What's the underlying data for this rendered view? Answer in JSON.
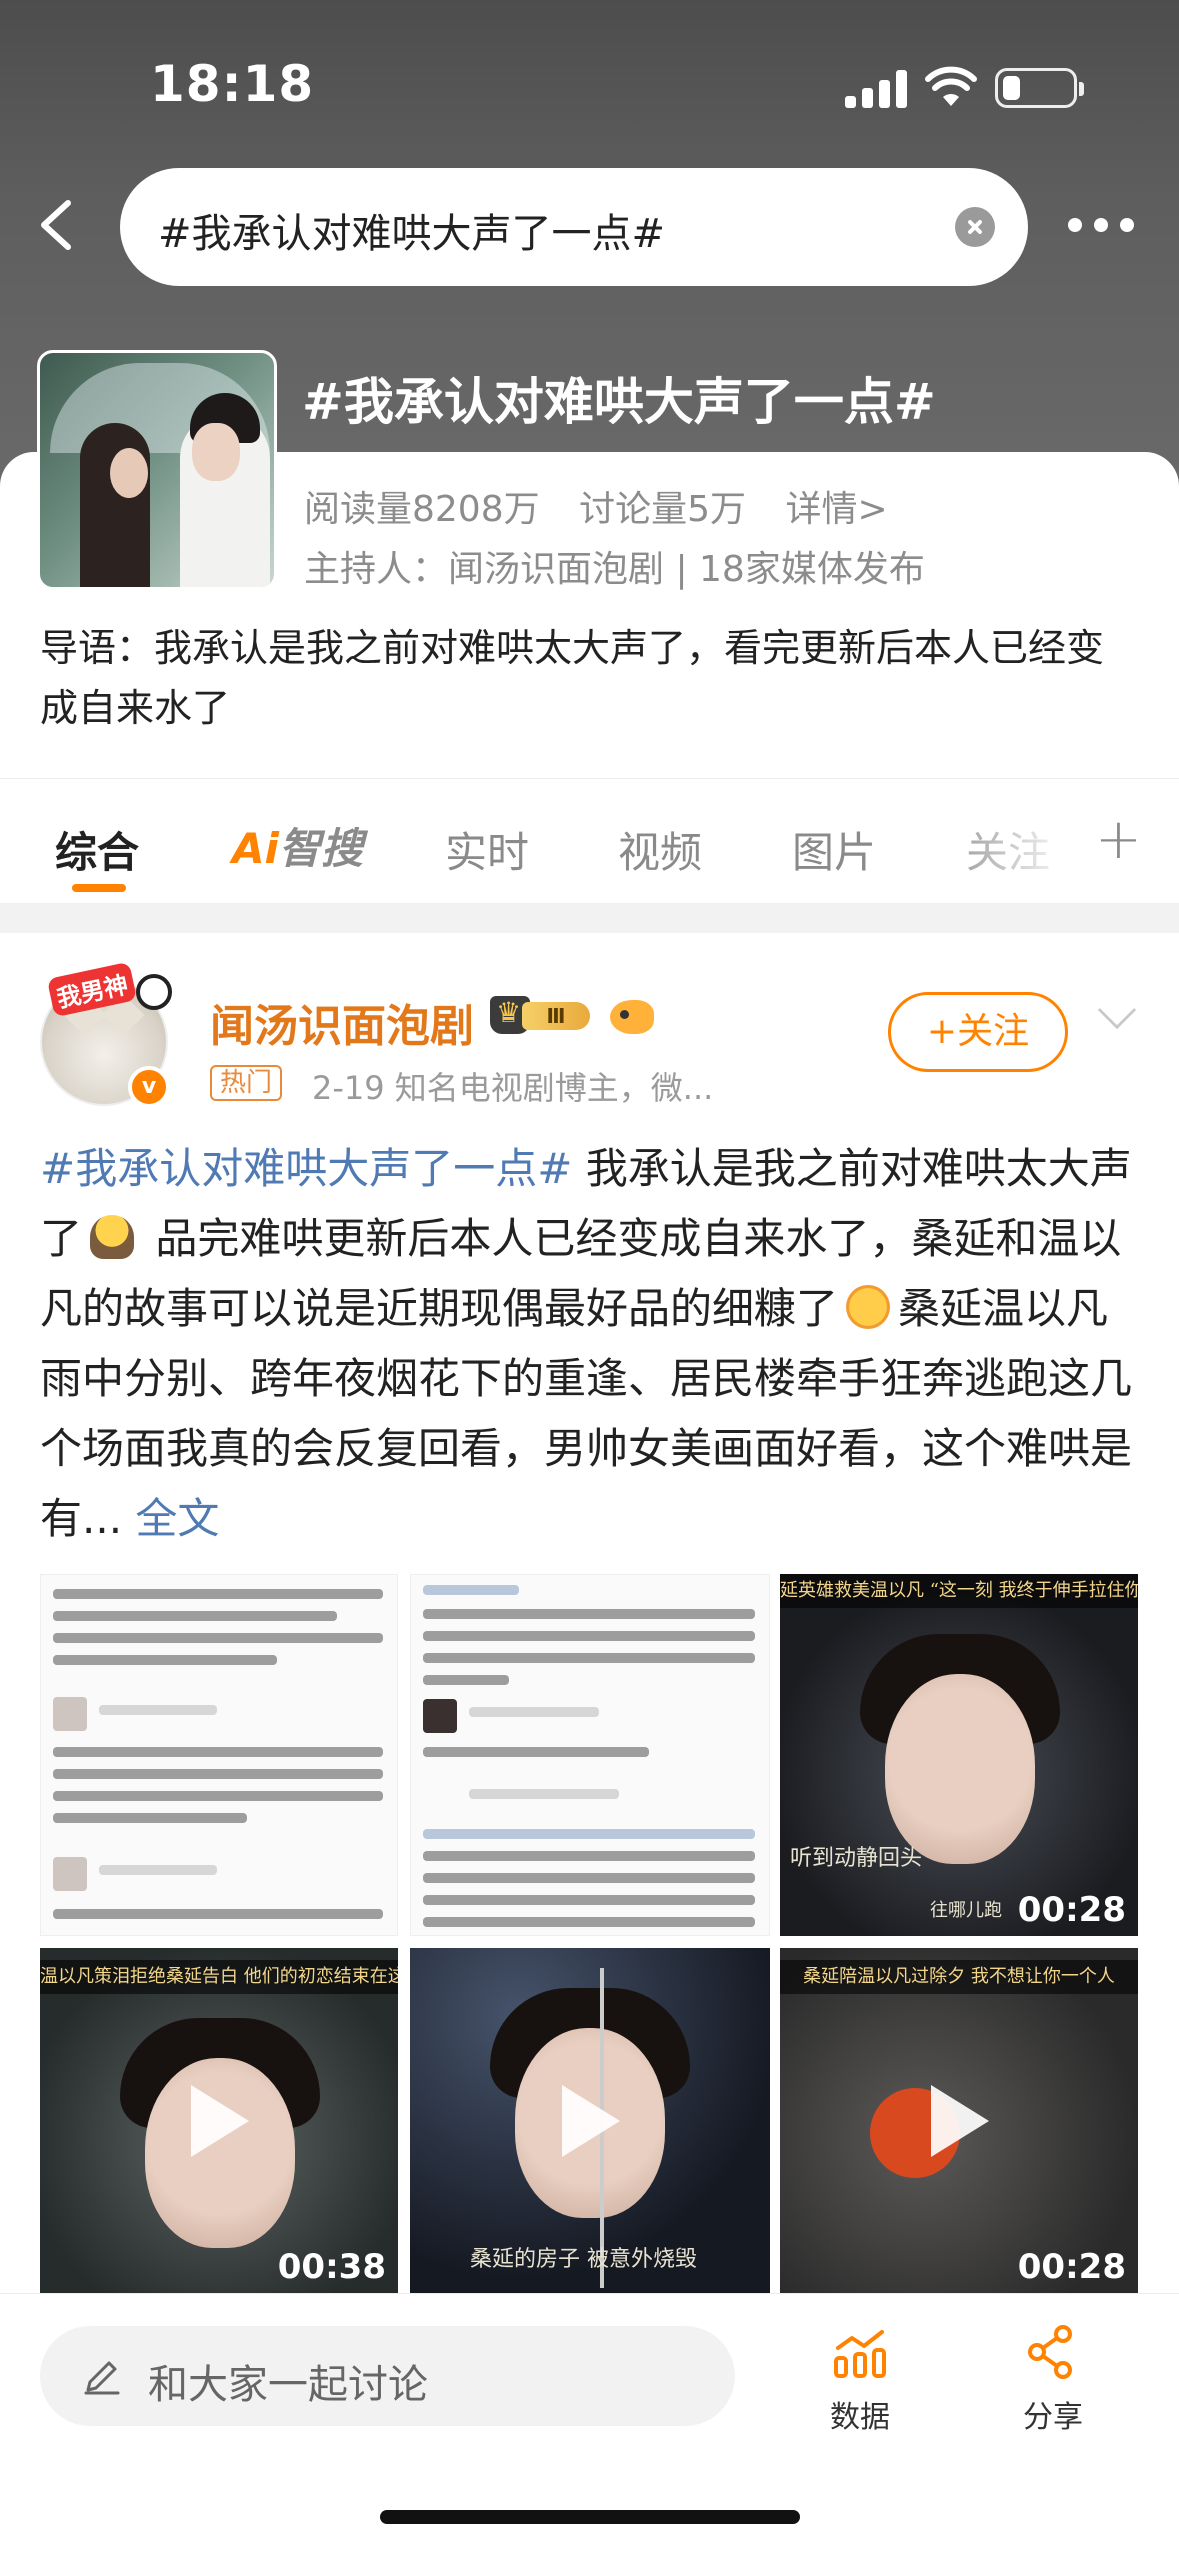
{
  "status_bar": {
    "time": "18:18"
  },
  "search": {
    "query": "#我承认对难哄大声了一点#"
  },
  "topic": {
    "title": "#我承认对难哄大声了一点#",
    "reads": "阅读量8208万",
    "discussions": "讨论量5万",
    "details_link": "详情>",
    "host_line": "主持人：闻汤识面泡剧 | 18家媒体发布",
    "intro": "导语：我承认是我之前对难哄太大声了，看完更新后本人已经变成自来水了"
  },
  "tabs": [
    {
      "label": "综合"
    },
    {
      "label": "智搜",
      "prefix": "Ai"
    },
    {
      "label": "实时"
    },
    {
      "label": "视频"
    },
    {
      "label": "图片"
    },
    {
      "label": "关注"
    }
  ],
  "post": {
    "author": "闻汤识面泡剧",
    "avatar_tag": "我男神",
    "level_badge": "Ⅲ",
    "hot_badge": "热门",
    "date_line": "2-19  知名电视剧博主，微...",
    "follow_label": "+关注",
    "topic_tag": "#我承认对难哄大声了一点#",
    "text_1": "  我承认是我之前对难哄太大声了",
    "text_2": "  品完难哄更新后本人已经变成自来水了，桑延和温以凡的故事可以说是近期现偶最好品的细糠了",
    "text_3": "桑延温以凡雨中分别、跨年夜烟花下的重逢、居民楼牵手狂奔逃跑这几个场面我真的会反复回看，男帅女美画面好看，这个难哄是有...",
    "more_link": " 全文",
    "media": [
      {
        "kind": "screenshot"
      },
      {
        "kind": "screenshot"
      },
      {
        "kind": "video",
        "caption": "延英雄救美温以凡 “这一刻 我终于伸手拉住你",
        "subtitle": "听到动静回头",
        "subtitle_right": "往哪儿跑",
        "duration": "00:28"
      },
      {
        "kind": "video",
        "caption": "温以凡策泪拒绝桑延告白 他们的初恋结束在这场大雨",
        "duration": "00:38"
      },
      {
        "kind": "video",
        "caption": "",
        "subtitle": "桑延的房子 被意外烧毁",
        "duration": ""
      },
      {
        "kind": "video",
        "caption": "桑延陪温以凡过除夕 我不想让你一个人",
        "duration": "00:28"
      }
    ]
  },
  "bottom_bar": {
    "discuss_placeholder": "和大家一起讨论",
    "data_label": "数据",
    "share_label": "分享"
  },
  "colors": {
    "accent": "#ff8200",
    "link": "#4f7ab3",
    "author": "#e2781a"
  }
}
